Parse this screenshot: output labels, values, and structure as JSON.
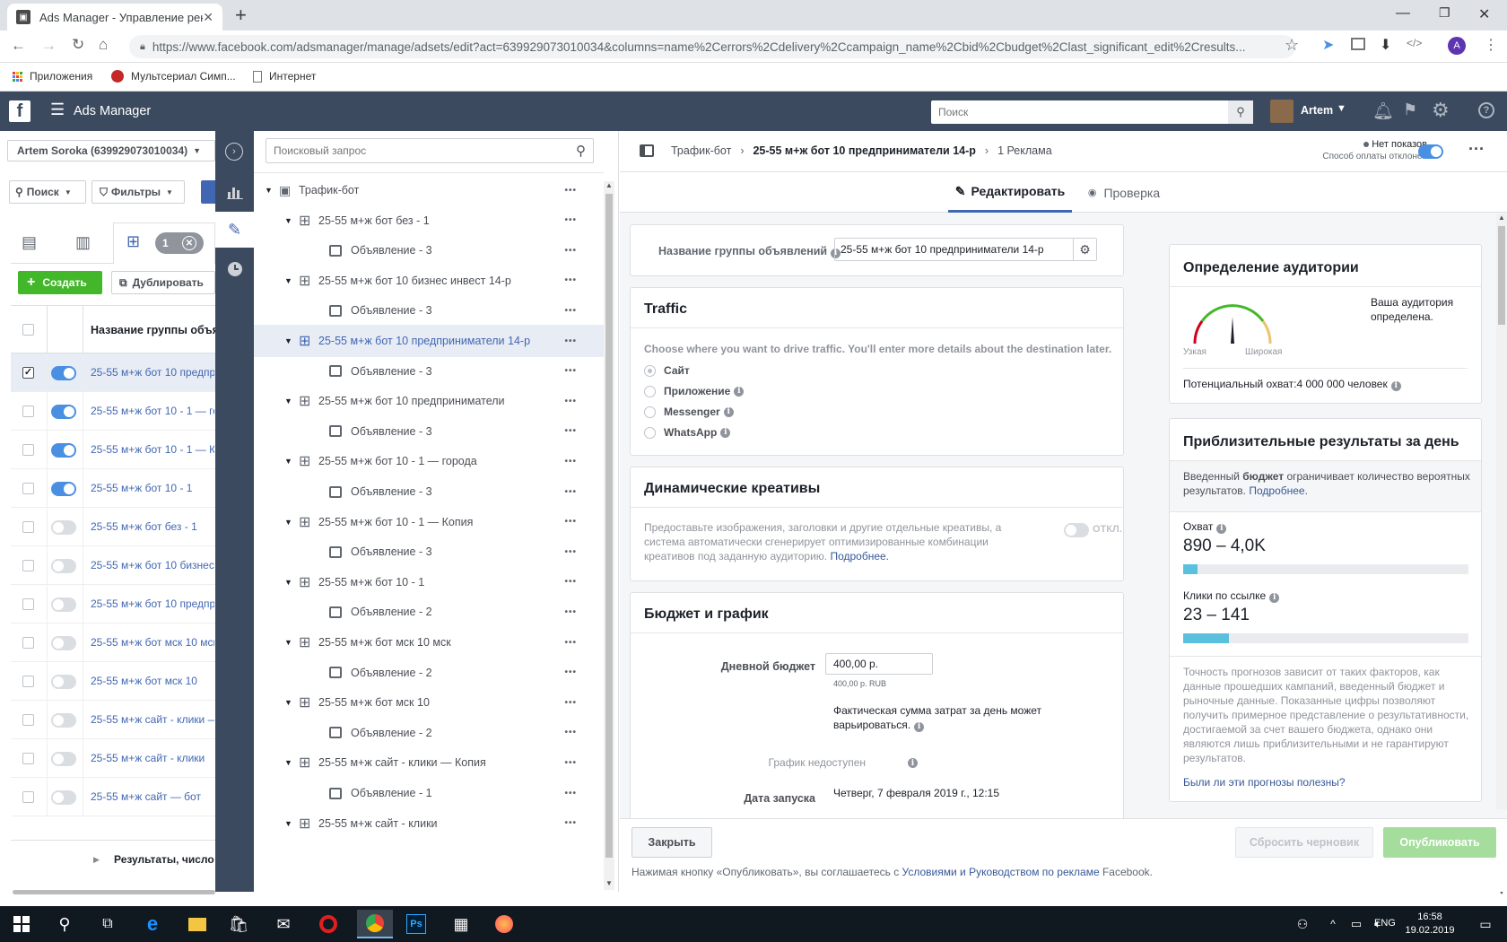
{
  "browser": {
    "tab_title": "Ads Manager - Управление рекл",
    "url": "https://www.facebook.com/adsmanager/manage/adsets/edit?act=639929073010034&columns=name%2Cerrors%2Cdelivery%2Ccampaign_name%2Cbid%2Cbudget%2Clast_significant_edit%2Cresults...",
    "bookmarks": [
      "Приложения",
      "Мультсериал Симп...",
      "Интернет"
    ],
    "profile_initial": "A"
  },
  "header": {
    "app_title": "Ads Manager",
    "search_placeholder": "Поиск",
    "user_name": "Artem"
  },
  "left_panel": {
    "account": "Artem Soroka (639929073010034)",
    "search_btn": "Поиск",
    "filters_btn": "Фильтры",
    "selected_count": "1",
    "create_btn": "Создать",
    "duplicate_btn": "Дублировать",
    "column_header": "Название группы объя",
    "rows": [
      {
        "name": "25-55 м+ж бот 10 предпр",
        "on": true,
        "checked": true
      },
      {
        "name": "25-55 м+ж бот 10 - 1 — го",
        "on": true,
        "checked": false
      },
      {
        "name": "25-55 м+ж бот 10 - 1 — К",
        "on": true,
        "checked": false
      },
      {
        "name": "25-55 м+ж бот 10 - 1",
        "on": true,
        "checked": false
      },
      {
        "name": "25-55 м+ж бот без - 1",
        "on": false,
        "checked": false
      },
      {
        "name": "25-55 м+ж бот 10 бизнес",
        "on": false,
        "checked": false
      },
      {
        "name": "25-55 м+ж бот 10 предпр",
        "on": false,
        "checked": false
      },
      {
        "name": "25-55 м+ж бот мск 10 мск",
        "on": false,
        "checked": false
      },
      {
        "name": "25-55 м+ж бот мск 10",
        "on": false,
        "checked": false
      },
      {
        "name": "25-55 м+ж сайт - клики —",
        "on": false,
        "checked": false
      },
      {
        "name": "25-55 м+ж сайт - клики",
        "on": false,
        "checked": false
      },
      {
        "name": "25-55 м+ж сайт — бот",
        "on": false,
        "checked": false
      }
    ],
    "footer": "Результаты, число"
  },
  "tree": {
    "search_placeholder": "Поисковый запрос",
    "items": [
      {
        "label": "Трафик-бот",
        "level": 0,
        "type": "campaign"
      },
      {
        "label": "25-55 м+ж бот без - 1",
        "level": 1,
        "type": "adset"
      },
      {
        "label": "Объявление - 3",
        "level": 2,
        "type": "ad"
      },
      {
        "label": "25-55 м+ж бот 10 бизнес инвест 14-р",
        "level": 1,
        "type": "adset"
      },
      {
        "label": "Объявление - 3",
        "level": 2,
        "type": "ad"
      },
      {
        "label": "25-55 м+ж бот 10 предприниматели 14-р",
        "level": 1,
        "type": "adset",
        "selected": true
      },
      {
        "label": "Объявление - 3",
        "level": 2,
        "type": "ad"
      },
      {
        "label": "25-55 м+ж бот 10 предприниматели",
        "level": 1,
        "type": "adset"
      },
      {
        "label": "Объявление - 3",
        "level": 2,
        "type": "ad"
      },
      {
        "label": "25-55 м+ж бот 10 - 1 — города",
        "level": 1,
        "type": "adset"
      },
      {
        "label": "Объявление - 3",
        "level": 2,
        "type": "ad"
      },
      {
        "label": "25-55 м+ж бот 10 - 1 — Копия",
        "level": 1,
        "type": "adset"
      },
      {
        "label": "Объявление - 3",
        "level": 2,
        "type": "ad"
      },
      {
        "label": "25-55 м+ж бот 10 - 1",
        "level": 1,
        "type": "adset"
      },
      {
        "label": "Объявление - 2",
        "level": 2,
        "type": "ad"
      },
      {
        "label": "25-55 м+ж бот мск 10 мск",
        "level": 1,
        "type": "adset"
      },
      {
        "label": "Объявление - 2",
        "level": 2,
        "type": "ad"
      },
      {
        "label": "25-55 м+ж бот мск 10",
        "level": 1,
        "type": "adset"
      },
      {
        "label": "Объявление - 2",
        "level": 2,
        "type": "ad"
      },
      {
        "label": "25-55 м+ж сайт - клики — Копия",
        "level": 1,
        "type": "adset"
      },
      {
        "label": "Объявление - 1",
        "level": 2,
        "type": "ad"
      },
      {
        "label": "25-55 м+ж сайт - клики",
        "level": 1,
        "type": "adset"
      }
    ]
  },
  "editor": {
    "breadcrumb": [
      "Трафик-бот",
      "25-55 м+ж бот 10 предприниматели 14-р",
      "1 Реклама"
    ],
    "status_line1": "Нет показов",
    "status_line2": "Способ оплаты отклонен",
    "tab_edit": "Редактировать",
    "tab_review": "Проверка",
    "adset_name_label": "Название группы объявлений",
    "adset_name_value": "25-55 м+ж бот 10 предприниматели 14-р",
    "traffic": {
      "title": "Traffic",
      "desc": "Choose where you want to drive traffic. You'll enter more details about the destination later.",
      "options": [
        "Сайт",
        "Приложение",
        "Messenger",
        "WhatsApp"
      ]
    },
    "dynamic": {
      "title": "Динамические креативы",
      "desc": "Предоставьте изображения, заголовки и другие отдельные креативы, а система автоматически сгенерирует оптимизированные комбинации креативов под заданную аудиторию.",
      "more": "Подробнее.",
      "toggle_label": "ОТКЛ."
    },
    "budget": {
      "title": "Бюджет и график",
      "daily_label": "Дневной бюджет",
      "daily_value": "400,00 р.",
      "daily_sub": "400,00 р. RUB",
      "note": "Фактическая сумма затрат за день может варьироваться.",
      "schedule_label": "График недоступен",
      "start_label": "Дата запуска",
      "start_value": "Четверг, 7 февраля 2019 г., 12:15"
    },
    "audience": {
      "title": "Определение аудитории",
      "narrow": "Узкая",
      "wide": "Широкая",
      "status": "Ваша аудитория определена.",
      "reach": "Потенциальный охват:4 000 000 человек"
    },
    "results": {
      "title": "Приблизительные результаты за день",
      "note_pre": "Введенный ",
      "note_bold": "бюджет",
      "note_post": " ограничивает количество вероятных результатов. ",
      "note_link": "Подробнее.",
      "reach_label": "Охват",
      "reach_value": "890 – 4,0K",
      "reach_fill": 0.05,
      "clicks_label": "Клики по ссылке",
      "clicks_value": "23 – 141",
      "clicks_fill": 0.16,
      "disclaimer": "Точность прогнозов зависит от таких факторов, как данные прошедших кампаний, введенный бюджет и рыночные данные. Показанные цифры позволяют получить примерное представление о результативности, достигаемой за счет вашего бюджета, однако они являются лишь приблизительными и не гарантируют результатов.",
      "feedback": "Были ли эти прогнозы полезны?"
    },
    "footer": {
      "close": "Закрыть",
      "discard": "Сбросить черновик",
      "publish": "Опубликовать",
      "terms_pre": "Нажимая кнопку «Опубликовать», вы соглашаетесь с ",
      "terms_link": "Условиями и Руководством по рекламе",
      "terms_post": " Facebook."
    }
  },
  "taskbar": {
    "lang": "ENG",
    "time": "16:58",
    "date": "19.02.2019"
  }
}
